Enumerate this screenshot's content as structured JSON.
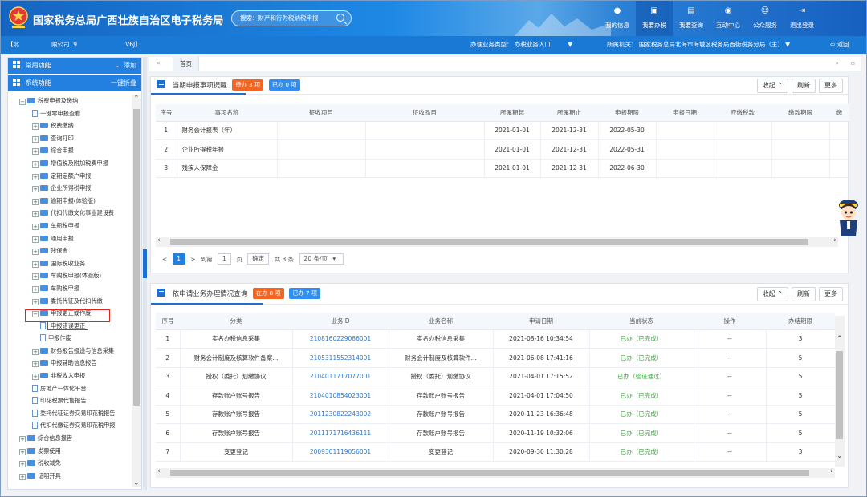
{
  "header": {
    "title": "国家税务总局广西壮族自治区电子税务局",
    "search_placeholder": "搜索：财产和行为税纳税申报",
    "nav": [
      {
        "label": "我的信息",
        "icon": "user-icon"
      },
      {
        "label": "我要办税",
        "icon": "monitor-icon"
      },
      {
        "label": "我要查询",
        "icon": "chart-icon"
      },
      {
        "label": "互动中心",
        "icon": "chat-icon"
      },
      {
        "label": "公众服务",
        "icon": "people-icon"
      },
      {
        "label": "退出登录",
        "icon": "logout-icon"
      }
    ]
  },
  "subheader": {
    "company_prefix": "【北",
    "company_mid": "限公司",
    "company_code_prefix": "9",
    "company_suffix": "V6J】",
    "business_type_label": "办理业务类型：",
    "business_type_value": "办税业务入口",
    "org_label": "所属机关：",
    "org_value": "国家税务总局北海市海城区税务局西街税务分局（主）",
    "back_label": "返回"
  },
  "sidebar": {
    "common": {
      "label": "常用功能",
      "action": "添加"
    },
    "system": {
      "label": "系统功能",
      "action": "一键折叠"
    },
    "tree": [
      {
        "label": "税费申报及缴纳",
        "level": 0,
        "type": "folder",
        "exp": "−"
      },
      {
        "label": "一键零申报查看",
        "level": 1,
        "type": "doc"
      },
      {
        "label": "税费缴纳",
        "level": 1,
        "type": "folder",
        "exp": "+"
      },
      {
        "label": "查询打印",
        "level": 1,
        "type": "folder",
        "exp": "+"
      },
      {
        "label": "综合申报",
        "level": 1,
        "type": "folder",
        "exp": "+"
      },
      {
        "label": "增值税及附加税费申报",
        "level": 1,
        "type": "folder",
        "exp": "+"
      },
      {
        "label": "定期定额户申报",
        "level": 1,
        "type": "folder",
        "exp": "+"
      },
      {
        "label": "企业所得税申报",
        "level": 1,
        "type": "folder",
        "exp": "+"
      },
      {
        "label": "逾期申报(体验版)",
        "level": 1,
        "type": "folder",
        "exp": "+"
      },
      {
        "label": "代扣代缴文化事业建设费",
        "level": 1,
        "type": "folder",
        "exp": "+"
      },
      {
        "label": "车船税申报",
        "level": 1,
        "type": "folder",
        "exp": "+"
      },
      {
        "label": "通用申报",
        "level": 1,
        "type": "folder",
        "exp": "+"
      },
      {
        "label": "残保金",
        "level": 1,
        "type": "folder",
        "exp": "+"
      },
      {
        "label": "国际税收业务",
        "level": 1,
        "type": "folder",
        "exp": "+"
      },
      {
        "label": "车购税申报(体验版)",
        "level": 1,
        "type": "folder",
        "exp": "+"
      },
      {
        "label": "车购税申报",
        "level": 1,
        "type": "folder",
        "exp": "+"
      },
      {
        "label": "委托代征及代扣代缴",
        "level": 1,
        "type": "folder",
        "exp": "+"
      },
      {
        "label": "申报更正或作废",
        "level": 1,
        "type": "folder",
        "exp": "−"
      },
      {
        "label": "申报错误更正",
        "level": 2,
        "type": "doc",
        "selected": true
      },
      {
        "label": "申报作废",
        "level": 2,
        "type": "doc"
      },
      {
        "label": "财务报告报送与信息采集",
        "level": 1,
        "type": "folder",
        "exp": "+"
      },
      {
        "label": "申报辅助信息报告",
        "level": 1,
        "type": "folder",
        "exp": "+"
      },
      {
        "label": "非税收入申报",
        "level": 1,
        "type": "folder",
        "exp": "+"
      },
      {
        "label": "房地产一体化平台",
        "level": 1,
        "type": "doc"
      },
      {
        "label": "印花税票代售报告",
        "level": 1,
        "type": "doc"
      },
      {
        "label": "委托代征证券交易印花税报告",
        "level": 1,
        "type": "doc"
      },
      {
        "label": "代扣代缴证券交易印花税申报",
        "level": 1,
        "type": "doc"
      },
      {
        "label": "综合信息报告",
        "level": 0,
        "type": "folder",
        "exp": "+"
      },
      {
        "label": "发票使用",
        "level": 0,
        "type": "folder",
        "exp": "+"
      },
      {
        "label": "税收减免",
        "level": 0,
        "type": "folder",
        "exp": "+"
      },
      {
        "label": "证明开具",
        "level": 0,
        "type": "folder",
        "exp": "+"
      }
    ]
  },
  "tabs": {
    "home": "首页"
  },
  "panel1": {
    "title": "当期申报事项提醒",
    "badge_pending": "待办 3 项",
    "badge_done": "已办 0 项",
    "collapse": "收起",
    "refresh": "刷新",
    "more": "更多",
    "columns": [
      "序号",
      "事项名称",
      "征收项目",
      "征收品目",
      "所属期起",
      "所属期止",
      "申报期限",
      "申报日期",
      "应缴税款",
      "缴款期限",
      "缴"
    ],
    "rows": [
      [
        "1",
        "财务会计报表（年）",
        "",
        "",
        "2021-01-01",
        "2021-12-31",
        "2022-05-30",
        "",
        "",
        ""
      ],
      [
        "2",
        "企业所得税年报",
        "",
        "",
        "2021-01-01",
        "2021-12-31",
        "2022-05-31",
        "",
        "",
        ""
      ],
      [
        "3",
        "残疾人保障金",
        "",
        "",
        "2021-01-01",
        "2021-12-31",
        "2022-06-30",
        "",
        "",
        ""
      ]
    ],
    "pager": {
      "page": "1",
      "goto": "到第",
      "page_input": "1",
      "page_unit": "页",
      "confirm": "确定",
      "total": "共 3 条",
      "page_size": "20 条/页"
    }
  },
  "panel2": {
    "title": "依申请业务办理情况查询",
    "badge_pending": "在办 8 项",
    "badge_done": "已办 7 项",
    "collapse": "收起",
    "refresh": "刷新",
    "more": "更多",
    "columns": [
      "序号",
      "分类",
      "业务ID",
      "业务名称",
      "申请日期",
      "当前状态",
      "操作",
      "办结期限"
    ],
    "rows": [
      [
        "1",
        "实名办税信息采集",
        "2108160229086001",
        "实名办税信息采集",
        "2021-08-16 10:34:54",
        "已办（已完成）",
        "--",
        "3"
      ],
      [
        "2",
        "财务会计制度及核算软件备案...",
        "2105311552314001",
        "财务会计制度及核算软件...",
        "2021-06-08 17:41:16",
        "已办（已完成）",
        "--",
        "5"
      ],
      [
        "3",
        "授权（委托）划缴协议",
        "2104011717077001",
        "授权（委托）划缴协议",
        "2021-04-01 17:15:52",
        "已办（验证通过）",
        "--",
        "5"
      ],
      [
        "4",
        "存款账户账号报告",
        "2104010854023001",
        "存款账户账号报告",
        "2021-04-01 17:04:50",
        "已办（已完成）",
        "--",
        "5"
      ],
      [
        "5",
        "存款账户账号报告",
        "2011230822243002",
        "存款账户账号报告",
        "2020-11-23 16:36:48",
        "已办（已完成）",
        "--",
        "5"
      ],
      [
        "6",
        "存款账户账号报告",
        "2011171716436111",
        "存款账户账号报告",
        "2020-11-19 10:32:06",
        "已办（已完成）",
        "--",
        "5"
      ],
      [
        "7",
        "变更登记",
        "2009301119056001",
        "变更登记",
        "2020-09-30 11:30:28",
        "已办（已完成）",
        "--",
        "3"
      ]
    ]
  },
  "colors": {
    "primary": "#1e6fd0",
    "header": "#1565c0",
    "badge_red": "#f26522",
    "badge_blue": "#2f8ef0",
    "ok_green": "#3aa83a",
    "highlight_red": "#e0261c"
  }
}
